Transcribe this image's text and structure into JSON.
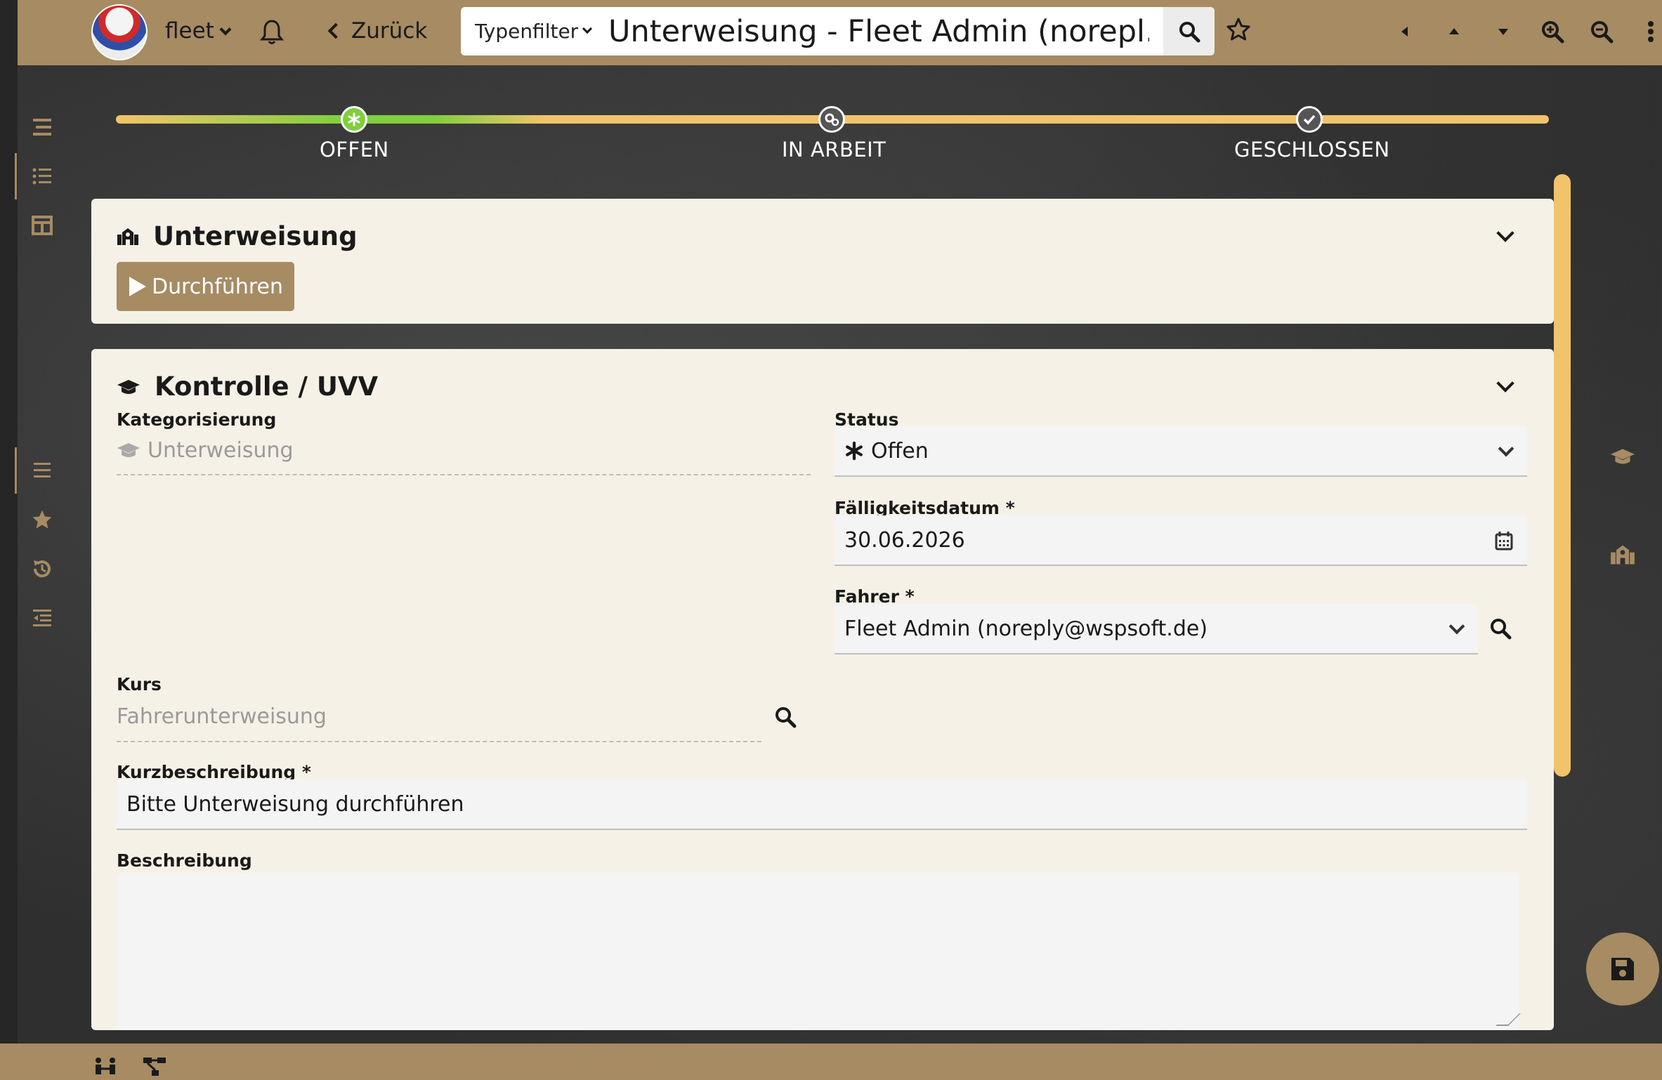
{
  "header": {
    "app_name": "fleet",
    "back_label": "Zurück",
    "type_filter_label": "Typenfilter",
    "search_title": "Unterweisung - Fleet Admin (norepl..."
  },
  "stepper": {
    "steps": [
      {
        "label": "OFFEN",
        "state": "active"
      },
      {
        "label": "IN ARBEIT",
        "state": "pending"
      },
      {
        "label": "GESCHLOSSEN",
        "state": "pending"
      }
    ]
  },
  "panel_unterweisung": {
    "title": "Unterweisung",
    "run_button_label": "Durchführen"
  },
  "panel_kontrolle": {
    "title": "Kontrolle / UVV",
    "kategorisierung": {
      "label": "Kategorisierung",
      "value": "Unterweisung"
    },
    "status": {
      "label": "Status",
      "value": "Offen"
    },
    "faelligkeitsdatum": {
      "label": "Fälligkeitsdatum *",
      "value": "30.06.2026"
    },
    "fahrer": {
      "label": "Fahrer *",
      "value": "Fleet Admin (noreply@wspsoft.de)"
    },
    "kurs": {
      "label": "Kurs",
      "value": "Fahrerunterweisung"
    },
    "kurzbeschreibung": {
      "label": "Kurzbeschreibung *",
      "value": "Bitte Unterweisung durchführen"
    },
    "beschreibung": {
      "label": "Beschreibung",
      "value": ""
    }
  },
  "colors": {
    "brand": "#a68b63",
    "progress_active": "#7fcf3e",
    "progress_pending": "#f1c46b",
    "panel_bg": "#f6f1e7"
  },
  "icons": [
    "bell-icon",
    "search-icon",
    "star-icon",
    "zoom-in-icon",
    "zoom-out-icon",
    "more-icon",
    "calendar-icon",
    "save-icon",
    "graduation-cap-icon",
    "school-icon"
  ]
}
